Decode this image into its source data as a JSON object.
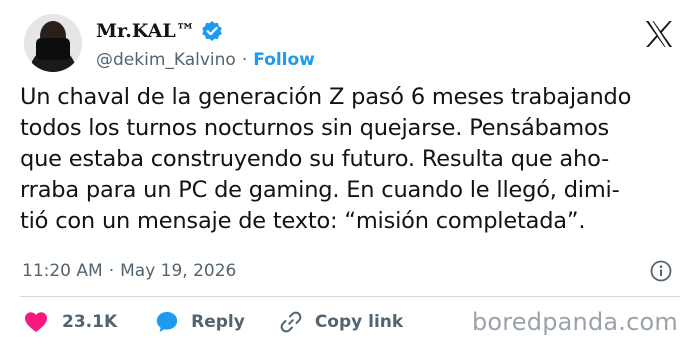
{
  "author": {
    "display_name": "Mr.KAL™",
    "handle": "@dekim_Kalvino",
    "separator": "·",
    "follow_label": "Follow"
  },
  "tweet": {
    "text": "Un chaval de la generación Z pasó 6 meses trabajando\ntodos los turnos nocturnos sin quejarse. Pensábamos\nque estaba construyendo su futuro. Resulta que aho-\nrraba para un PC de gaming. En cuando le llegó, dimi-\ntió con un mensaje de texto: “misión completada”.",
    "time": "11:20 AM",
    "separator": "·",
    "date": "May 19, 2026"
  },
  "actions": {
    "likes_count": "23.1K",
    "reply_label": "Reply",
    "copy_link_label": "Copy link"
  },
  "watermark": "boredpanda.com",
  "colors": {
    "accent": "#1d9bf0",
    "like": "#f91880",
    "text": "#0f1419",
    "secondary": "#536471"
  },
  "icons": {
    "verified": "verified-badge-icon",
    "platform": "x-logo-icon",
    "info": "info-icon",
    "like": "heart-icon",
    "reply": "speech-bubble-icon",
    "copy": "link-icon"
  }
}
